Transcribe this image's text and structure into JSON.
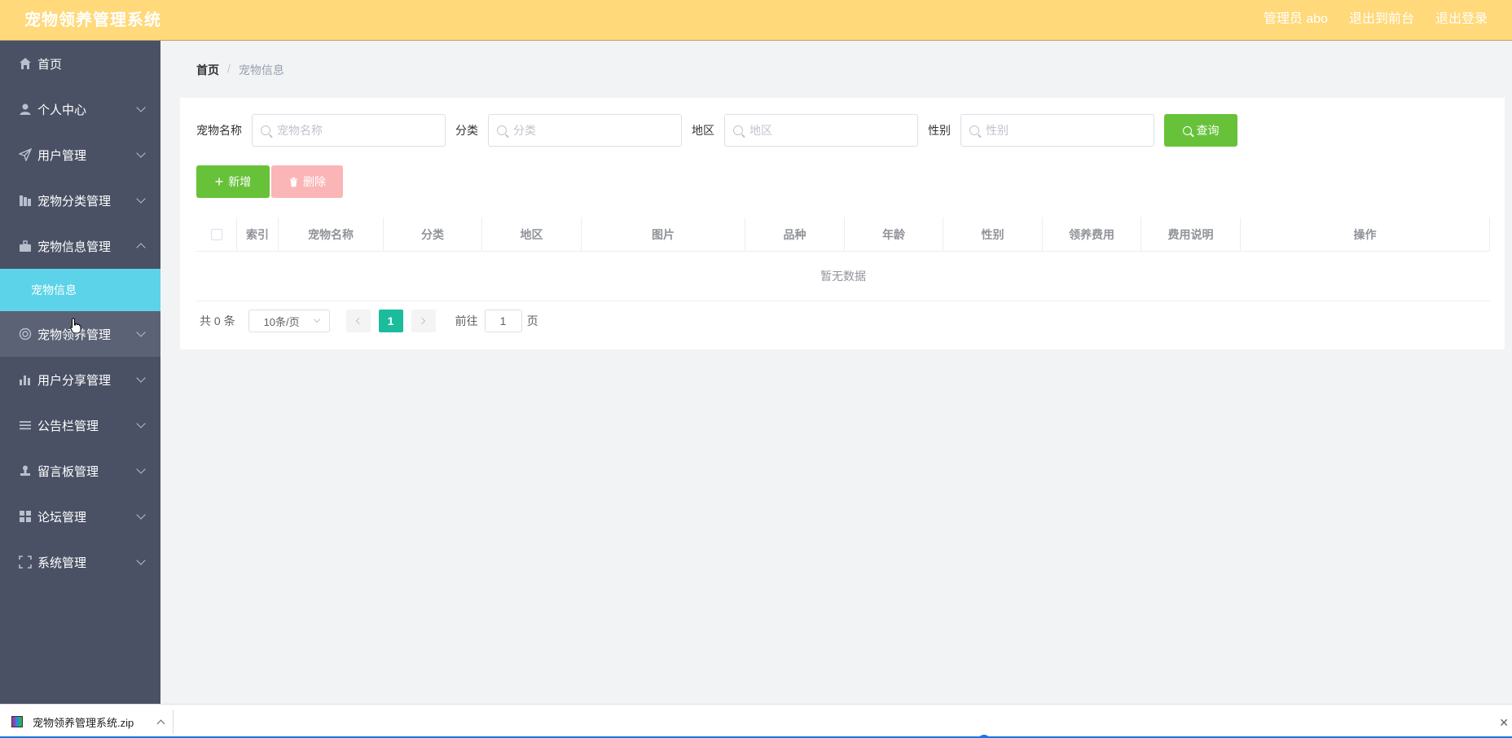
{
  "header": {
    "title": "宠物领养管理系统",
    "admin_label": "管理员 abo",
    "to_front": "退出到前台",
    "logout": "退出登录"
  },
  "sidebar": {
    "items": [
      {
        "label": "首页",
        "icon": "home-icon"
      },
      {
        "label": "个人中心",
        "icon": "user-icon"
      },
      {
        "label": "用户管理",
        "icon": "send-icon"
      },
      {
        "label": "宠物分类管理",
        "icon": "building-icon"
      },
      {
        "label": "宠物信息管理",
        "icon": "suitcase-icon"
      },
      {
        "label": "宠物领养管理",
        "icon": "help-circle-icon"
      },
      {
        "label": "用户分享管理",
        "icon": "bar-chart-icon"
      },
      {
        "label": "公告栏管理",
        "icon": "list-icon"
      },
      {
        "label": "留言板管理",
        "icon": "stamp-icon"
      },
      {
        "label": "论坛管理",
        "icon": "grid-icon"
      },
      {
        "label": "系统管理",
        "icon": "fullscreen-icon"
      }
    ],
    "sub_active": "宠物信息"
  },
  "breadcrumb": {
    "home": "首页",
    "separator": "/",
    "current": "宠物信息"
  },
  "search": {
    "name_label": "宠物名称",
    "name_placeholder": "宠物名称",
    "category_label": "分类",
    "category_placeholder": "分类",
    "region_label": "地区",
    "region_placeholder": "地区",
    "gender_label": "性别",
    "gender_placeholder": "性别",
    "query_button": "查询"
  },
  "actions": {
    "add": "新增",
    "delete": "删除"
  },
  "table": {
    "columns": [
      "索引",
      "宠物名称",
      "分类",
      "地区",
      "图片",
      "品种",
      "年龄",
      "性别",
      "领养费用",
      "费用说明",
      "操作"
    ],
    "empty_text": "暂无数据"
  },
  "pagination": {
    "total": "共 0 条",
    "page_size": "10条/页",
    "current_page": "1",
    "goto_label": "前往",
    "goto_value": "1",
    "page_suffix": "页"
  },
  "download_bar": {
    "filename": "宠物领养管理系统.zip"
  },
  "colors": {
    "header_bg": "#ffd97a",
    "sidebar_bg": "#4a5164",
    "submenu_active": "#5cd3e8",
    "primary_green": "#67c23a",
    "delete_disabled": "#fab6b6",
    "page_active": "#1abc9c"
  }
}
